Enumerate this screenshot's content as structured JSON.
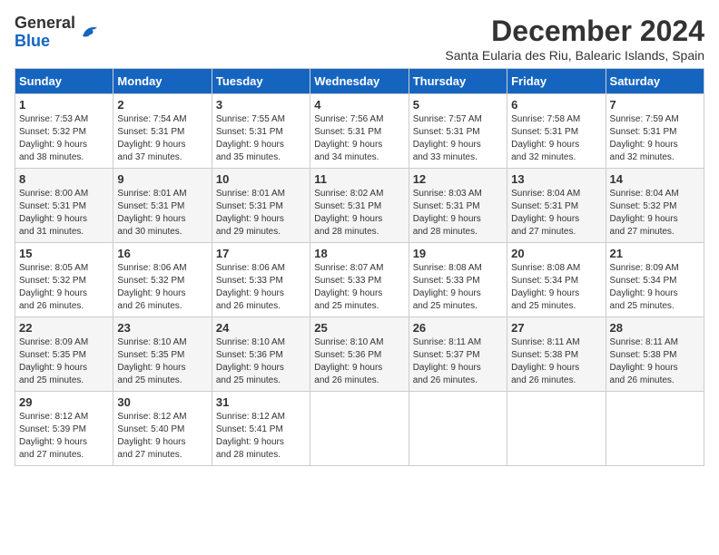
{
  "header": {
    "logo_general": "General",
    "logo_blue": "Blue",
    "month_title": "December 2024",
    "subtitle": "Santa Eularia des Riu, Balearic Islands, Spain"
  },
  "calendar": {
    "days_of_week": [
      "Sunday",
      "Monday",
      "Tuesday",
      "Wednesday",
      "Thursday",
      "Friday",
      "Saturday"
    ],
    "weeks": [
      [
        {
          "day": "",
          "content": ""
        },
        {
          "day": "2",
          "content": "Sunrise: 7:54 AM\nSunset: 5:31 PM\nDaylight: 9 hours and 37 minutes."
        },
        {
          "day": "3",
          "content": "Sunrise: 7:55 AM\nSunset: 5:31 PM\nDaylight: 9 hours and 35 minutes."
        },
        {
          "day": "4",
          "content": "Sunrise: 7:56 AM\nSunset: 5:31 PM\nDaylight: 9 hours and 34 minutes."
        },
        {
          "day": "5",
          "content": "Sunrise: 7:57 AM\nSunset: 5:31 PM\nDaylight: 9 hours and 33 minutes."
        },
        {
          "day": "6",
          "content": "Sunrise: 7:58 AM\nSunset: 5:31 PM\nDaylight: 9 hours and 32 minutes."
        },
        {
          "day": "7",
          "content": "Sunrise: 7:59 AM\nSunset: 5:31 PM\nDaylight: 9 hours and 32 minutes."
        }
      ],
      [
        {
          "day": "1",
          "content": "Sunrise: 7:53 AM\nSunset: 5:32 PM\nDaylight: 9 hours and 38 minutes."
        },
        {
          "day": "",
          "content": ""
        },
        {
          "day": "",
          "content": ""
        },
        {
          "day": "",
          "content": ""
        },
        {
          "day": "",
          "content": ""
        },
        {
          "day": "",
          "content": ""
        },
        {
          "day": "",
          "content": ""
        }
      ],
      [
        {
          "day": "8",
          "content": "Sunrise: 8:00 AM\nSunset: 5:31 PM\nDaylight: 9 hours and 31 minutes."
        },
        {
          "day": "9",
          "content": "Sunrise: 8:01 AM\nSunset: 5:31 PM\nDaylight: 9 hours and 30 minutes."
        },
        {
          "day": "10",
          "content": "Sunrise: 8:01 AM\nSunset: 5:31 PM\nDaylight: 9 hours and 29 minutes."
        },
        {
          "day": "11",
          "content": "Sunrise: 8:02 AM\nSunset: 5:31 PM\nDaylight: 9 hours and 28 minutes."
        },
        {
          "day": "12",
          "content": "Sunrise: 8:03 AM\nSunset: 5:31 PM\nDaylight: 9 hours and 28 minutes."
        },
        {
          "day": "13",
          "content": "Sunrise: 8:04 AM\nSunset: 5:31 PM\nDaylight: 9 hours and 27 minutes."
        },
        {
          "day": "14",
          "content": "Sunrise: 8:04 AM\nSunset: 5:32 PM\nDaylight: 9 hours and 27 minutes."
        }
      ],
      [
        {
          "day": "15",
          "content": "Sunrise: 8:05 AM\nSunset: 5:32 PM\nDaylight: 9 hours and 26 minutes."
        },
        {
          "day": "16",
          "content": "Sunrise: 8:06 AM\nSunset: 5:32 PM\nDaylight: 9 hours and 26 minutes."
        },
        {
          "day": "17",
          "content": "Sunrise: 8:06 AM\nSunset: 5:33 PM\nDaylight: 9 hours and 26 minutes."
        },
        {
          "day": "18",
          "content": "Sunrise: 8:07 AM\nSunset: 5:33 PM\nDaylight: 9 hours and 25 minutes."
        },
        {
          "day": "19",
          "content": "Sunrise: 8:08 AM\nSunset: 5:33 PM\nDaylight: 9 hours and 25 minutes."
        },
        {
          "day": "20",
          "content": "Sunrise: 8:08 AM\nSunset: 5:34 PM\nDaylight: 9 hours and 25 minutes."
        },
        {
          "day": "21",
          "content": "Sunrise: 8:09 AM\nSunset: 5:34 PM\nDaylight: 9 hours and 25 minutes."
        }
      ],
      [
        {
          "day": "22",
          "content": "Sunrise: 8:09 AM\nSunset: 5:35 PM\nDaylight: 9 hours and 25 minutes."
        },
        {
          "day": "23",
          "content": "Sunrise: 8:10 AM\nSunset: 5:35 PM\nDaylight: 9 hours and 25 minutes."
        },
        {
          "day": "24",
          "content": "Sunrise: 8:10 AM\nSunset: 5:36 PM\nDaylight: 9 hours and 25 minutes."
        },
        {
          "day": "25",
          "content": "Sunrise: 8:10 AM\nSunset: 5:36 PM\nDaylight: 9 hours and 26 minutes."
        },
        {
          "day": "26",
          "content": "Sunrise: 8:11 AM\nSunset: 5:37 PM\nDaylight: 9 hours and 26 minutes."
        },
        {
          "day": "27",
          "content": "Sunrise: 8:11 AM\nSunset: 5:38 PM\nDaylight: 9 hours and 26 minutes."
        },
        {
          "day": "28",
          "content": "Sunrise: 8:11 AM\nSunset: 5:38 PM\nDaylight: 9 hours and 26 minutes."
        }
      ],
      [
        {
          "day": "29",
          "content": "Sunrise: 8:12 AM\nSunset: 5:39 PM\nDaylight: 9 hours and 27 minutes."
        },
        {
          "day": "30",
          "content": "Sunrise: 8:12 AM\nSunset: 5:40 PM\nDaylight: 9 hours and 27 minutes."
        },
        {
          "day": "31",
          "content": "Sunrise: 8:12 AM\nSunset: 5:41 PM\nDaylight: 9 hours and 28 minutes."
        },
        {
          "day": "",
          "content": ""
        },
        {
          "day": "",
          "content": ""
        },
        {
          "day": "",
          "content": ""
        },
        {
          "day": "",
          "content": ""
        }
      ]
    ]
  }
}
